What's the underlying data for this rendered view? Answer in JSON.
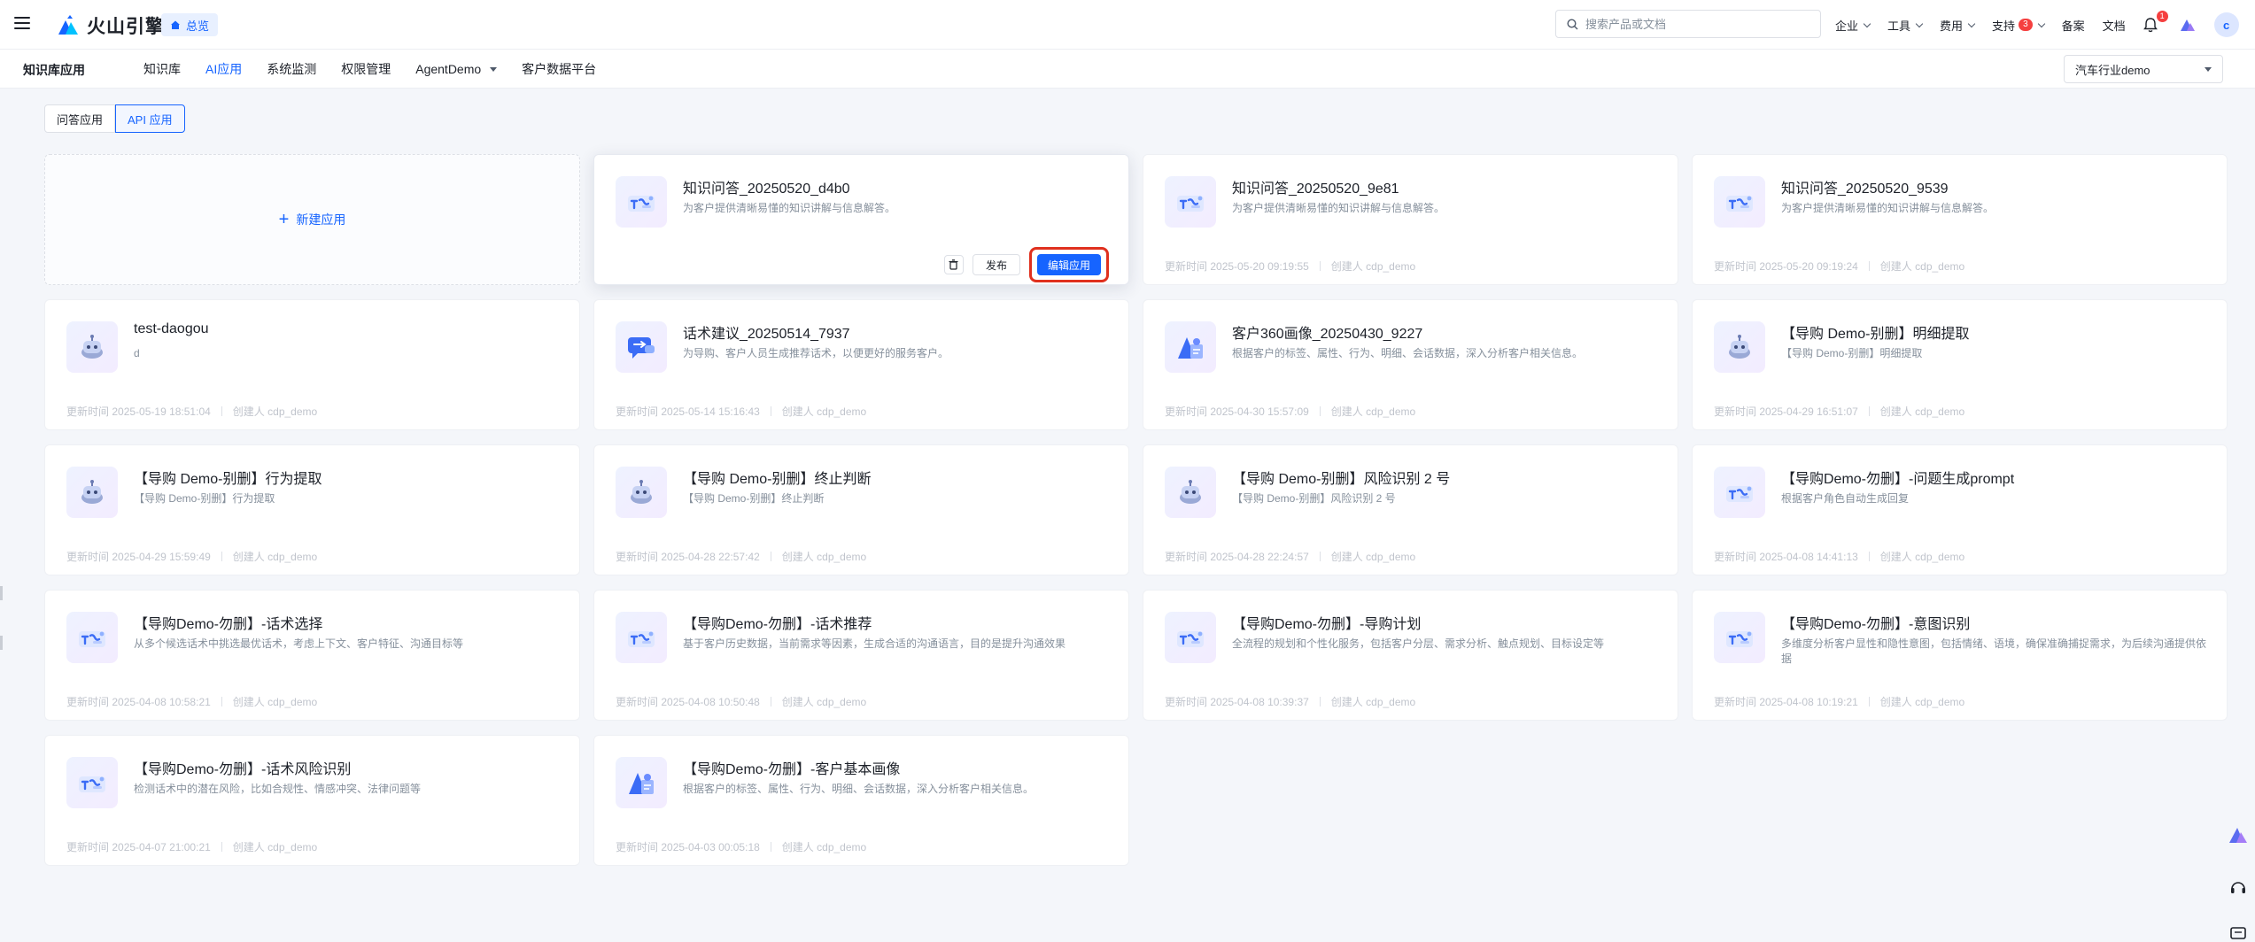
{
  "header": {
    "brand": "火山引擎",
    "overview": "总览",
    "search_placeholder": "搜索产品或文档",
    "nav": [
      {
        "label": "企业",
        "dropdown": true
      },
      {
        "label": "工具",
        "dropdown": true
      },
      {
        "label": "费用",
        "dropdown": true
      },
      {
        "label": "支持",
        "dropdown": true,
        "badge": "3"
      },
      {
        "label": "备案",
        "dropdown": false
      },
      {
        "label": "文档",
        "dropdown": false
      }
    ],
    "bell_badge": "1",
    "avatar_letter": "c"
  },
  "subnav": {
    "section_title": "知识库应用",
    "tabs": [
      {
        "label": "知识库",
        "active": false
      },
      {
        "label": "AI应用",
        "active": true
      },
      {
        "label": "系统监测",
        "active": false
      },
      {
        "label": "权限管理",
        "active": false
      },
      {
        "label": "AgentDemo",
        "active": false,
        "dropdown": true
      },
      {
        "label": "客户数据平台",
        "active": false
      }
    ],
    "workspace": "汽车行业demo"
  },
  "segments": [
    {
      "label": "问答应用",
      "active": false
    },
    {
      "label": "API 应用",
      "active": true
    }
  ],
  "new_app_label": "新建应用",
  "labels": {
    "updated_prefix": "更新时间",
    "creator_prefix": "创建人",
    "publish": "发布",
    "edit": "编辑应用"
  },
  "apps": [
    {
      "title": "知识问答_20250520_d4b0",
      "desc": "为客户提供清晰易懂的知识讲解与信息解答。",
      "updated": "",
      "creator": "",
      "icon": "qa-icon",
      "hover": true
    },
    {
      "title": "知识问答_20250520_9e81",
      "desc": "为客户提供清晰易懂的知识讲解与信息解答。",
      "updated": "2025-05-20 09:19:55",
      "creator": "cdp_demo",
      "icon": "qa-icon"
    },
    {
      "title": "知识问答_20250520_9539",
      "desc": "为客户提供清晰易懂的知识讲解与信息解答。",
      "updated": "2025-05-20 09:19:24",
      "creator": "cdp_demo",
      "icon": "qa-icon"
    },
    {
      "title": "test-daogou",
      "desc": "d",
      "updated": "2025-05-19 18:51:04",
      "creator": "cdp_demo",
      "icon": "robot-icon"
    },
    {
      "title": "话术建议_20250514_7937",
      "desc": "为导购、客户人员生成推荐话术，以便更好的服务客户。",
      "updated": "2025-05-14 15:16:43",
      "creator": "cdp_demo",
      "icon": "chat-icon"
    },
    {
      "title": "客户360画像_20250430_9227",
      "desc": "根据客户的标签、属性、行为、明细、会话数据，深入分析客户相关信息。",
      "updated": "2025-04-30 15:57:09",
      "creator": "cdp_demo",
      "icon": "profile-icon"
    },
    {
      "title": "【导购 Demo-别删】明细提取",
      "desc": "【导购 Demo-别删】明细提取",
      "updated": "2025-04-29 16:51:07",
      "creator": "cdp_demo",
      "icon": "robot-icon"
    },
    {
      "title": "【导购 Demo-别删】行为提取",
      "desc": "【导购 Demo-别删】行为提取",
      "updated": "2025-04-29 15:59:49",
      "creator": "cdp_demo",
      "icon": "robot-icon"
    },
    {
      "title": "【导购 Demo-别删】终止判断",
      "desc": "【导购 Demo-别删】终止判断",
      "updated": "2025-04-28 22:57:42",
      "creator": "cdp_demo",
      "icon": "robot-icon"
    },
    {
      "title": "【导购 Demo-别删】风险识别 2 号",
      "desc": "【导购 Demo-别删】风险识别 2 号",
      "updated": "2025-04-28 22:24:57",
      "creator": "cdp_demo",
      "icon": "robot-icon"
    },
    {
      "title": "【导购Demo-勿删】-问题生成prompt",
      "desc": "根据客户角色自动生成回复",
      "updated": "2025-04-08 14:41:13",
      "creator": "cdp_demo",
      "icon": "qa-icon"
    },
    {
      "title": "【导购Demo-勿删】-话术选择",
      "desc": "从多个候选话术中挑选最优话术，考虑上下文、客户特征、沟通目标等",
      "updated": "2025-04-08 10:58:21",
      "creator": "cdp_demo",
      "icon": "qa-icon"
    },
    {
      "title": "【导购Demo-勿删】-话术推荐",
      "desc": "基于客户历史数据，当前需求等因素，生成合适的沟通语言，目的是提升沟通效果",
      "updated": "2025-04-08 10:50:48",
      "creator": "cdp_demo",
      "icon": "qa-icon"
    },
    {
      "title": "【导购Demo-勿删】-导购计划",
      "desc": "全流程的规划和个性化服务，包括客户分层、需求分析、触点规划、目标设定等",
      "updated": "2025-04-08 10:39:37",
      "creator": "cdp_demo",
      "icon": "qa-icon"
    },
    {
      "title": "【导购Demo-勿删】-意图识别",
      "desc": "多维度分析客户显性和隐性意图，包括情绪、语境，确保准确捕捉需求，为后续沟通提供依据",
      "updated": "2025-04-08 10:19:21",
      "creator": "cdp_demo",
      "icon": "qa-icon"
    },
    {
      "title": "【导购Demo-勿删】-话术风险识别",
      "desc": "检测话术中的潜在风险，比如合规性、情感冲突、法律问题等",
      "updated": "2025-04-07 21:00:21",
      "creator": "cdp_demo",
      "icon": "qa-icon"
    },
    {
      "title": "【导购Demo-勿删】-客户基本画像",
      "desc": "根据客户的标签、属性、行为、明细、会话数据，深入分析客户相关信息。",
      "updated": "2025-04-03 00:05:18",
      "creator": "cdp_demo",
      "icon": "profile-icon"
    }
  ],
  "colors": {
    "accent": "#1664ff",
    "highlight": "#e0301e"
  }
}
